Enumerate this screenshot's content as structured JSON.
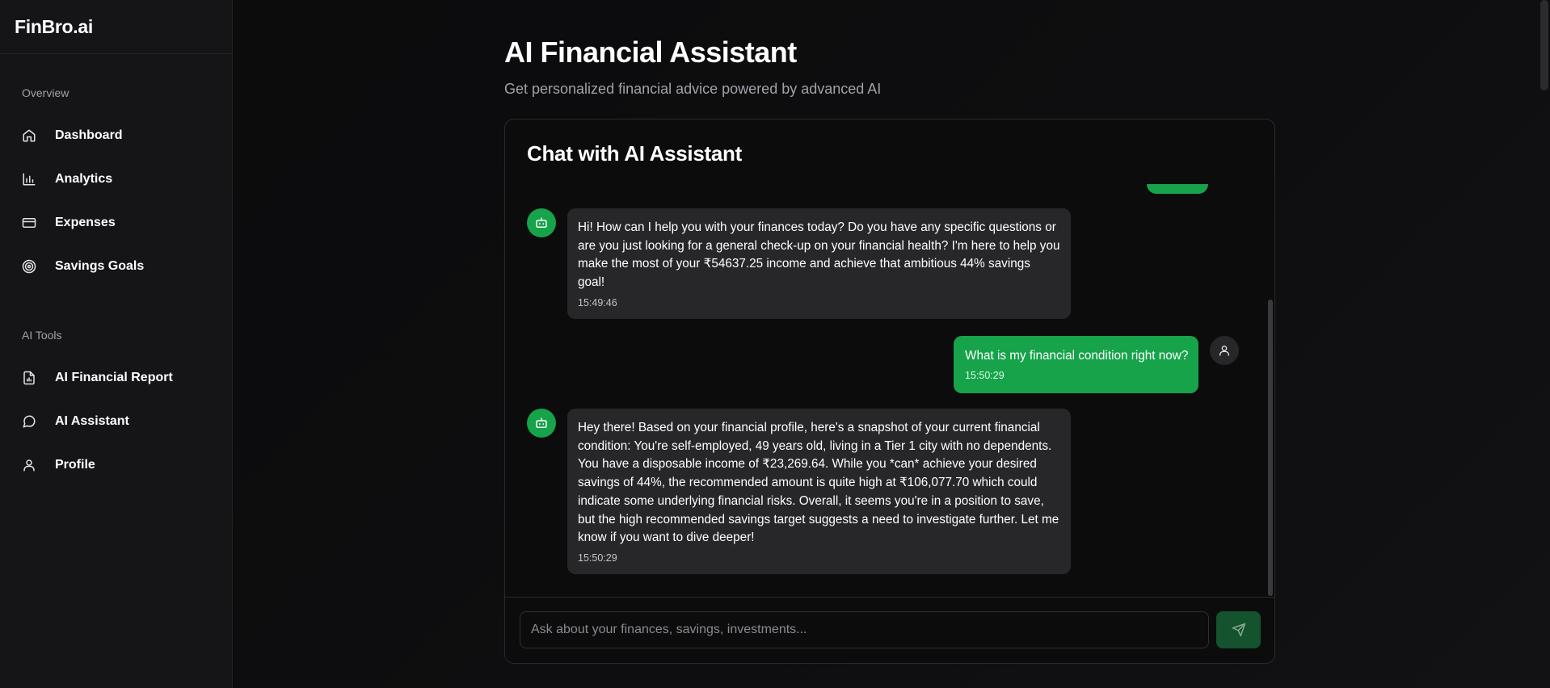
{
  "sidebar": {
    "brand": "FinBro.ai",
    "sections": {
      "overview": "Overview",
      "ai_tools": "AI Tools"
    },
    "overview_items": [
      {
        "label": "Dashboard",
        "icon": "home-icon"
      },
      {
        "label": "Analytics",
        "icon": "bar-chart-icon"
      },
      {
        "label": "Expenses",
        "icon": "credit-card-icon"
      },
      {
        "label": "Savings Goals",
        "icon": "target-icon"
      }
    ],
    "ai_items": [
      {
        "label": "AI Financial Report",
        "icon": "file-report-icon"
      },
      {
        "label": "AI Assistant",
        "icon": "message-circle-icon"
      },
      {
        "label": "Profile",
        "icon": "user-icon"
      }
    ]
  },
  "main": {
    "title": "AI Financial Assistant",
    "subtitle": "Get personalized financial advice powered by advanced AI"
  },
  "chat": {
    "title": "Chat with AI Assistant",
    "messages": [
      {
        "role": "assistant",
        "text": "Hi! How can I help you with your finances today? Do you have any specific questions or are you just looking for a general check-up on your financial health? I'm here to help you make the most of your ₹54637.25 income and achieve that ambitious 44% savings goal!",
        "time": "15:49:46"
      },
      {
        "role": "user",
        "text": "What is my financial condition right now?",
        "time": "15:50:29"
      },
      {
        "role": "assistant",
        "text": "Hey there! Based on your financial profile, here's a snapshot of your current financial condition: You're self-employed, 49 years old, living in a Tier 1 city with no dependents. You have a disposable income of ₹23,269.64. While you *can* achieve your desired savings of 44%, the recommended amount is quite high at ₹106,077.70 which could indicate some underlying financial risks. Overall, it seems you're in a position to save, but the high recommended savings target suggests a need to investigate further. Let me know if you want to dive deeper!",
        "time": "15:50:29"
      }
    ],
    "input_placeholder": "Ask about your finances, savings, investments...",
    "input_value": ""
  },
  "colors": {
    "accent": "#16a34a",
    "accent_dark": "#14532d",
    "background": "#0b0b0c",
    "sidebar": "#151517",
    "bubble_ai": "#27272a"
  }
}
